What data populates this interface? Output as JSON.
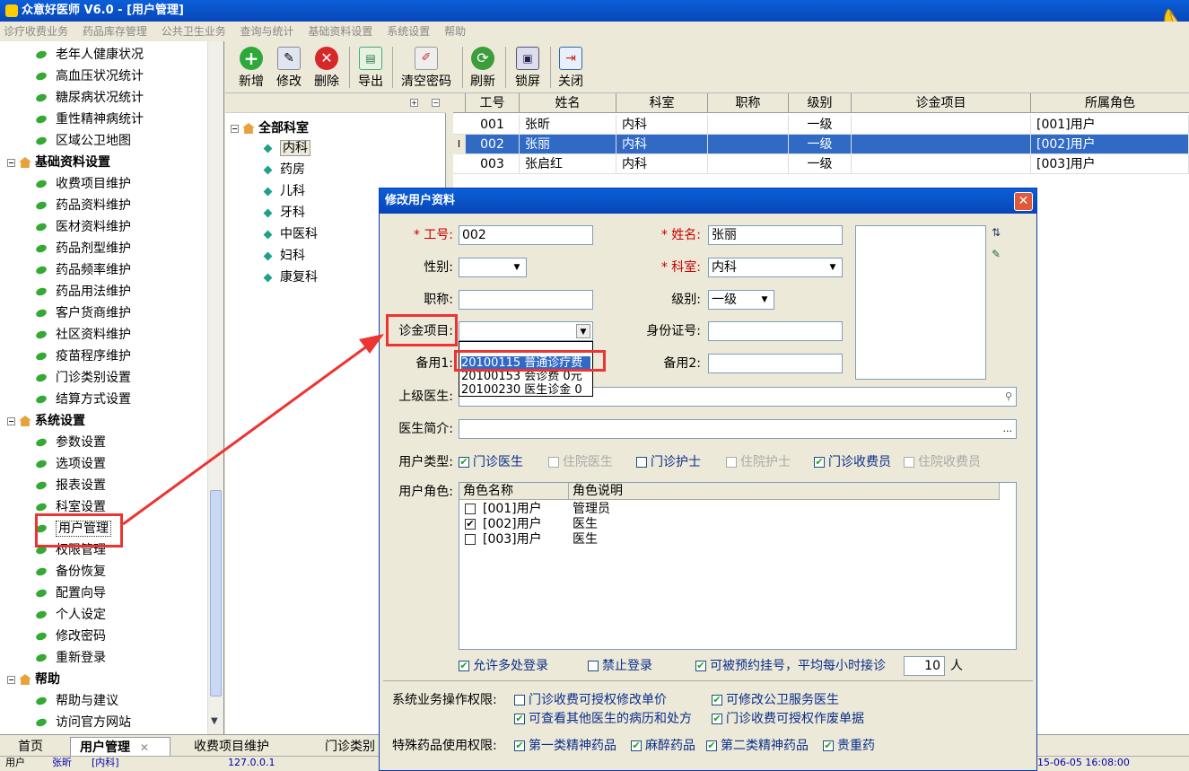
{
  "app": {
    "title": "众意好医师 V6.0 - [用户管理]"
  },
  "menu": [
    "诊疗收费业务",
    "药品库存管理",
    "公共卫生业务",
    "查询与统计",
    "基础资料设置",
    "系统设置",
    "帮助"
  ],
  "left_tree": {
    "top_items": [
      "老年人健康状况",
      "高血压状况统计",
      "糖尿病状况统计",
      "重性精神病统计",
      "区域公卫地图"
    ],
    "group_basic": "基础资料设置",
    "basic_items": [
      "收费项目维护",
      "药品资料维护",
      "医材资料维护",
      "药品剂型维护",
      "药品频率维护",
      "药品用法维护",
      "客户货商维护",
      "社区资料维护",
      "疫苗程序维护",
      "门诊类别设置",
      "结算方式设置"
    ],
    "group_system": "系统设置",
    "system_items": [
      "参数设置",
      "选项设置",
      "报表设置",
      "科室设置",
      "用户管理",
      "权限管理",
      "备份恢复",
      "配置向导",
      "个人设定",
      "修改密码",
      "重新登录"
    ],
    "group_help": "帮助",
    "help_items": [
      "帮助与建议",
      "访问官方网站"
    ]
  },
  "toolbar": {
    "add": "新增",
    "edit": "修改",
    "delete": "删除",
    "export": "导出",
    "clear_pwd": "清空密码",
    "refresh": "刷新",
    "lock": "锁屏",
    "close": "关闭"
  },
  "dept_tree": {
    "root": "全部科室",
    "items": [
      "内科",
      "药房",
      "儿科",
      "牙科",
      "中医科",
      "妇科",
      "康复科"
    ]
  },
  "grid": {
    "columns": [
      "工号",
      "姓名",
      "科室",
      "职称",
      "级别",
      "诊金项目",
      "所属角色"
    ],
    "rows": [
      [
        "001",
        "张昕",
        "内科",
        "",
        "一级",
        "",
        "[001]用户"
      ],
      [
        "002",
        "张丽",
        "内科",
        "",
        "一级",
        "",
        "[002]用户"
      ],
      [
        "003",
        "张启红",
        "内科",
        "",
        "一级",
        "",
        "[003]用户"
      ]
    ],
    "row_marker": "I"
  },
  "dialog": {
    "title": "修改用户资料",
    "close": "✕",
    "req_mark": "*",
    "lbl_id": "工号:",
    "val_id": "002",
    "lbl_name": "姓名:",
    "val_name": "张丽",
    "lbl_gender": "性别:",
    "val_gender": "",
    "lbl_dept": "科室:",
    "val_dept": "内科",
    "lbl_title": "职称:",
    "val_title": "",
    "lbl_level": "级别:",
    "val_level": "一级",
    "lbl_fee": "诊金项目:",
    "val_fee": "",
    "lbl_idcard": "身份证号:",
    "val_idcard": "",
    "lbl_spare1": "备用1:",
    "lbl_spare2": "备用2:",
    "lbl_superior": "上级医生:",
    "lbl_intro": "医生简介:",
    "intro_btn": "...",
    "lbl_usertype": "用户类型:",
    "usertypes": [
      {
        "label": "门诊医生",
        "checked": true,
        "enabled": true
      },
      {
        "label": "住院医生",
        "checked": false,
        "enabled": false
      },
      {
        "label": "门诊护士",
        "checked": false,
        "enabled": true
      },
      {
        "label": "住院护士",
        "checked": false,
        "enabled": false
      },
      {
        "label": "门诊收费员",
        "checked": true,
        "enabled": true
      },
      {
        "label": "住院收费员",
        "checked": false,
        "enabled": false
      }
    ],
    "lbl_roles": "用户角色:",
    "role_cols": [
      "角色名称",
      "角色说明"
    ],
    "roles": [
      {
        "name": "[001]用户",
        "desc": "管理员",
        "checked": false
      },
      {
        "name": "[002]用户",
        "desc": "医生",
        "checked": true
      },
      {
        "name": "[003]用户",
        "desc": "医生",
        "checked": false
      }
    ],
    "multi_login": "允许多处登录",
    "ban_login": "禁止登录",
    "appointment": "可被预约挂号，平均每小时接诊",
    "appointment_val": "10",
    "appointment_unit": "人",
    "perm_label": "系统业务操作权限:",
    "perms": [
      {
        "label": "门诊收费可授权修改单价",
        "checked": false
      },
      {
        "label": "可修改公卫服务医生",
        "checked": true
      },
      {
        "label": "可查看其他医生的病历和处方",
        "checked": true
      },
      {
        "label": "门诊收费可授权作废单据",
        "checked": true
      }
    ],
    "drug_label": "特殊药品使用权限:",
    "drugs": [
      {
        "label": "第一类精神药品",
        "checked": true
      },
      {
        "label": "麻醉药品",
        "checked": true
      },
      {
        "label": "第二类精神药品",
        "checked": true
      },
      {
        "label": "贵重药",
        "checked": true
      }
    ],
    "dropdown": [
      "20100115 普通诊疗费",
      "20100153 会诊费 0元",
      "20100230 医生诊金 0"
    ]
  },
  "tabs": {
    "home": "首页",
    "user": "用户管理",
    "user_close": "✕",
    "fee": "收费项目维护",
    "clinic": "门诊类别"
  },
  "status": {
    "user_label": "用户",
    "user_val": "张昕",
    "dept_val": "[内科]",
    "host": "127.0.0.1",
    "time": "15-06-05 16:08:00"
  },
  "colors": {
    "accent": "#316ac5",
    "annotation": "#e33333",
    "title_bar": "#0a5fd8"
  }
}
